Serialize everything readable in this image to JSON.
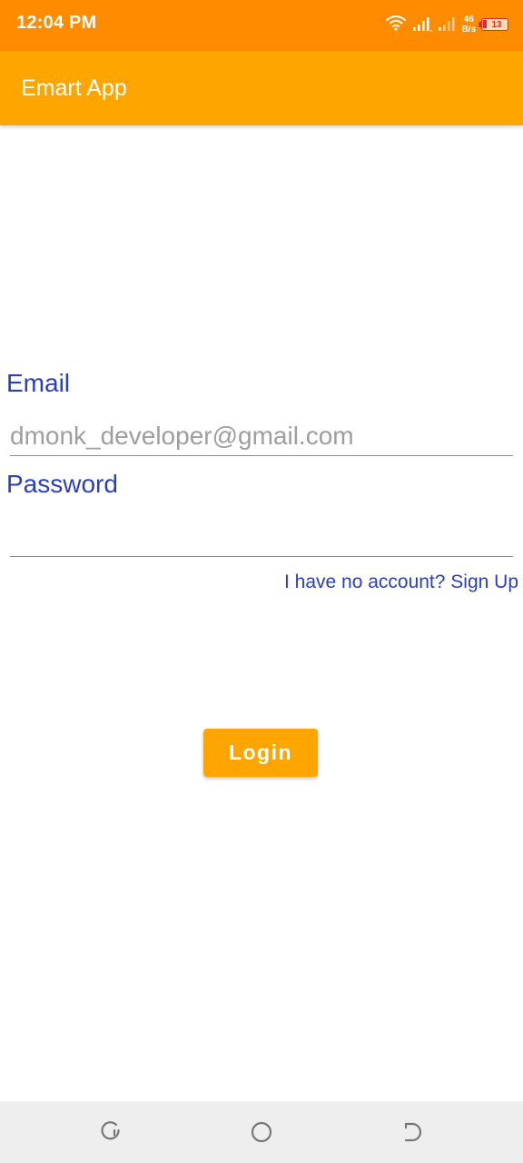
{
  "status_bar": {
    "time": "12:04 PM",
    "net_speed_value": "46",
    "net_speed_unit": "B/s",
    "battery_level": "13",
    "icons": [
      "wifi-icon",
      "signal-icon",
      "signal-icon",
      "battery-icon"
    ],
    "background_color": "#FF8C00"
  },
  "app_bar": {
    "title": "Emart App",
    "background_color": "#FFA500"
  },
  "form": {
    "email_label": "Email",
    "email_value": "dmonk_developer@gmail.com",
    "password_label": "Password",
    "password_value": "",
    "signup_link": "I have no account? Sign Up",
    "login_button": "Login",
    "label_color": "#2B3FBE",
    "button_color": "#FFA500"
  },
  "nav_bar": {
    "buttons": [
      "recents-icon",
      "home-icon",
      "back-icon"
    ]
  }
}
